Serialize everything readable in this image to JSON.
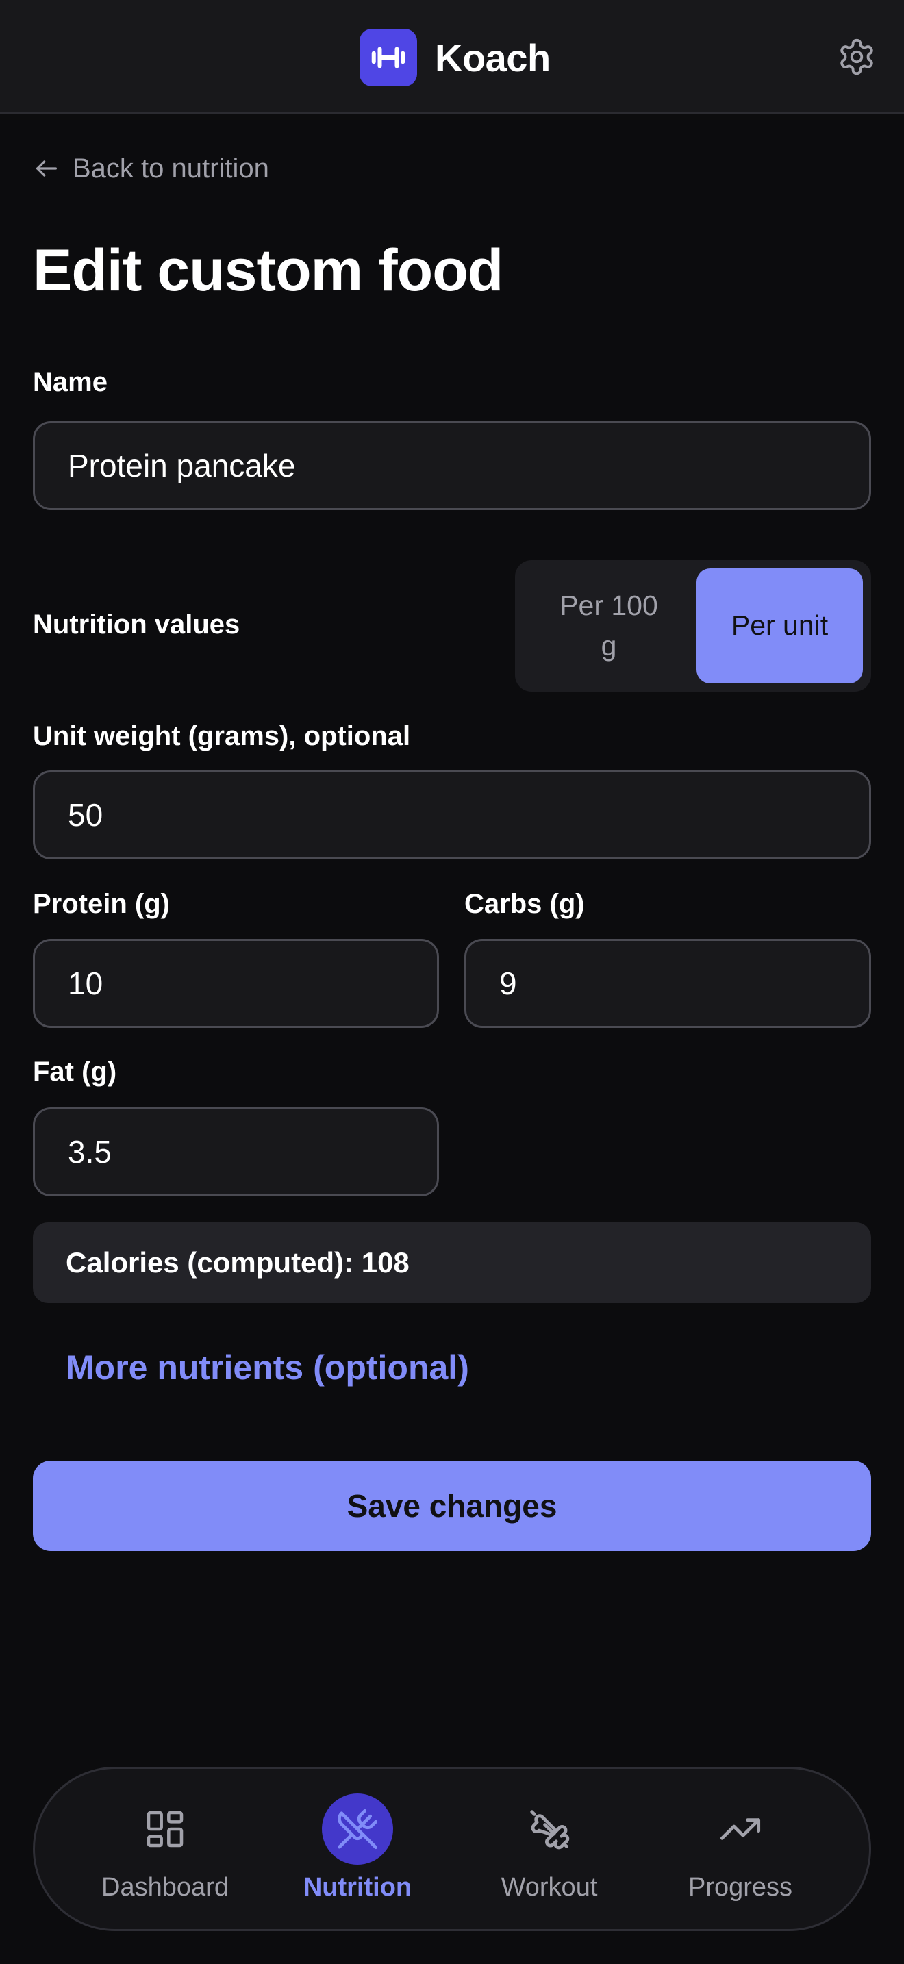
{
  "header": {
    "app_name": "Koach",
    "logo_icon": "dumbbell-icon",
    "settings_icon": "gear-icon",
    "accent": "#4f46e5"
  },
  "back_link": {
    "label": "Back to nutrition",
    "icon": "arrow-left-icon"
  },
  "page_title": "Edit custom food",
  "form": {
    "name": {
      "label": "Name",
      "value": "Protein pancake"
    },
    "nutrition_values": {
      "label": "Nutrition values",
      "options": [
        "Per 100 g",
        "Per unit"
      ],
      "selected": "Per unit"
    },
    "unit_weight": {
      "label": "Unit weight (grams), optional",
      "value": "50"
    },
    "protein": {
      "label": "Protein (g)",
      "value": "10"
    },
    "carbs": {
      "label": "Carbs (g)",
      "value": "9"
    },
    "fat": {
      "label": "Fat (g)",
      "value": "3.5"
    },
    "calories_text": "Calories (computed): 108",
    "more_nutrients": "More nutrients (optional)",
    "save_label": "Save changes"
  },
  "nav": {
    "items": [
      {
        "label": "Dashboard",
        "icon": "grid-icon",
        "active": false
      },
      {
        "label": "Nutrition",
        "icon": "utensils-icon",
        "active": true
      },
      {
        "label": "Workout",
        "icon": "dumbbell-icon",
        "active": false
      },
      {
        "label": "Progress",
        "icon": "trending-up-icon",
        "active": false
      }
    ]
  },
  "colors": {
    "accent_light": "#818cf8",
    "background": "#0c0c0e",
    "surface": "#18181b"
  }
}
